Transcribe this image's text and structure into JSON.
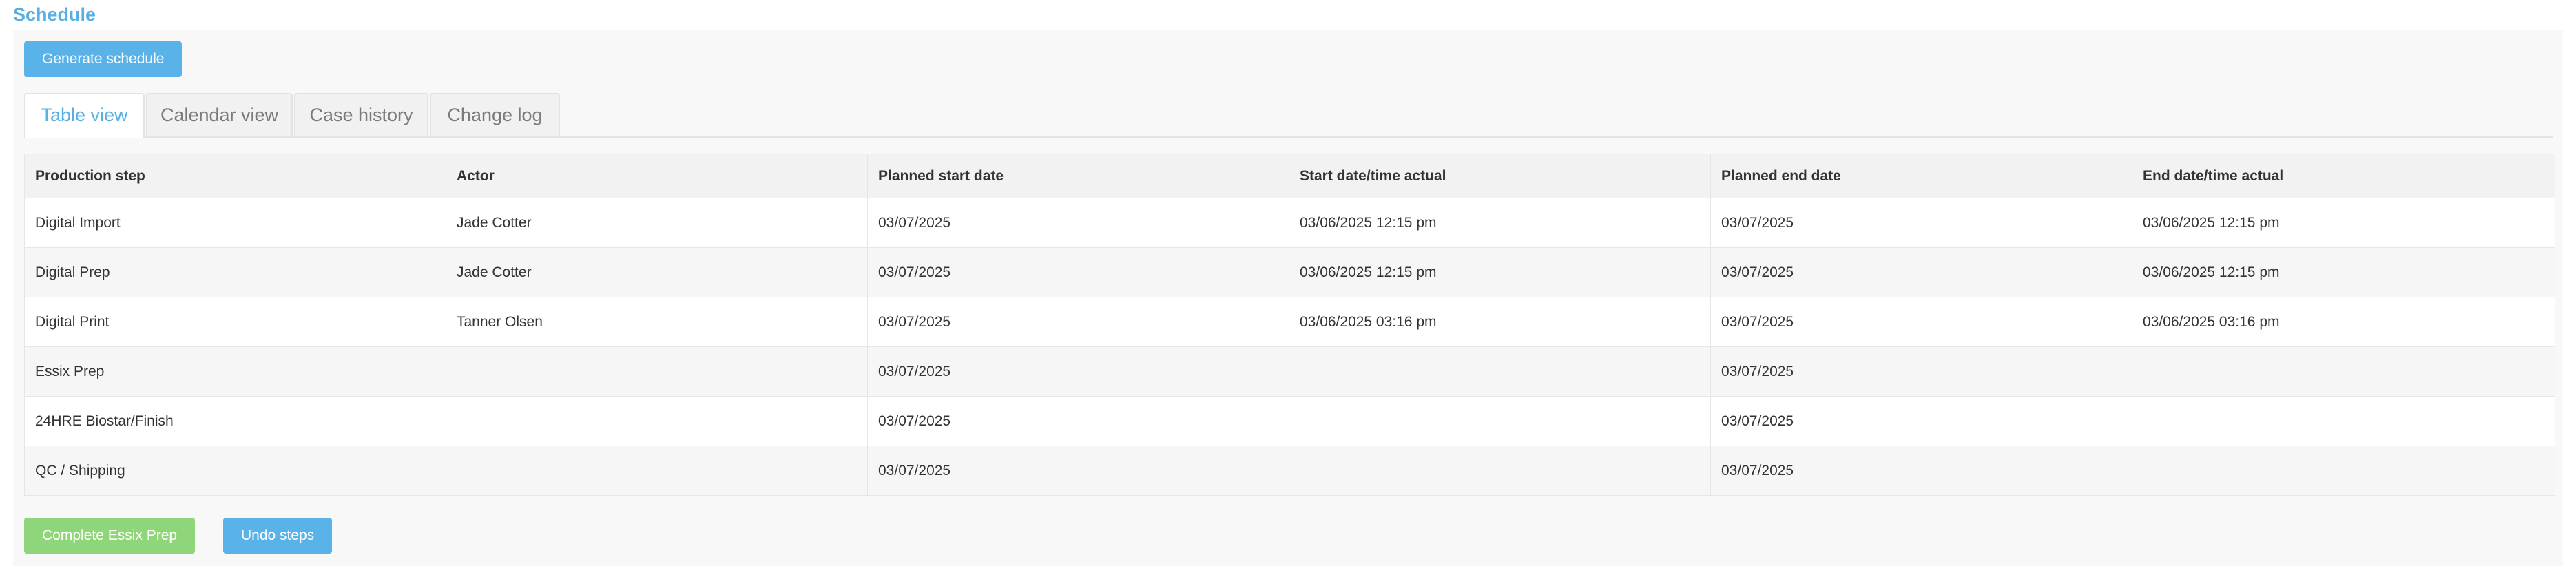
{
  "section": {
    "title": "Schedule"
  },
  "buttons": {
    "generate": "Generate schedule",
    "complete": "Complete Essix Prep",
    "undo": "Undo steps"
  },
  "tabs": [
    {
      "label": "Table view",
      "active": true
    },
    {
      "label": "Calendar view",
      "active": false
    },
    {
      "label": "Case history",
      "active": false
    },
    {
      "label": "Change log",
      "active": false
    }
  ],
  "table": {
    "headers": [
      "Production step",
      "Actor",
      "Planned start date",
      "Start date/time actual",
      "Planned end date",
      "End date/time actual"
    ],
    "rows": [
      [
        "Digital Import",
        "Jade Cotter",
        "03/07/2025",
        "03/06/2025 12:15 pm",
        "03/07/2025",
        "03/06/2025 12:15 pm"
      ],
      [
        "Digital Prep",
        "Jade Cotter",
        "03/07/2025",
        "03/06/2025 12:15 pm",
        "03/07/2025",
        "03/06/2025 12:15 pm"
      ],
      [
        "Digital Print",
        "Tanner Olsen",
        "03/07/2025",
        "03/06/2025 03:16 pm",
        "03/07/2025",
        "03/06/2025 03:16 pm"
      ],
      [
        "Essix Prep",
        "",
        "03/07/2025",
        "",
        "03/07/2025",
        ""
      ],
      [
        "24HRE Biostar/Finish",
        "",
        "03/07/2025",
        "",
        "03/07/2025",
        ""
      ],
      [
        "QC / Shipping",
        "",
        "03/07/2025",
        "",
        "03/07/2025",
        ""
      ]
    ]
  },
  "colors": {
    "accent": "#5aafe2",
    "button_blue": "#5ab3e8",
    "button_green": "#8fd67a"
  }
}
